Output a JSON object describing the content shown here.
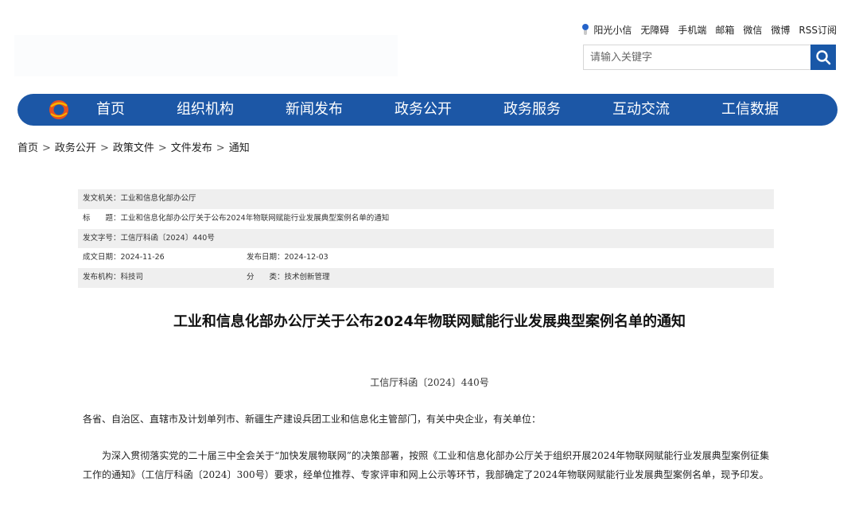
{
  "top_links": [
    "阳光小信",
    "无障碍",
    "手机端",
    "邮箱",
    "微信",
    "微博",
    "RSS订阅"
  ],
  "search": {
    "placeholder": "请输入关键字"
  },
  "nav": {
    "items": [
      "首页",
      "组织机构",
      "新闻发布",
      "政务公开",
      "政务服务",
      "互动交流",
      "工信数据"
    ]
  },
  "breadcrumb": [
    "首页",
    "政务公开",
    "政策文件",
    "文件发布",
    "通知"
  ],
  "meta": {
    "issuer_label": "发文机关：",
    "issuer": "工业和信息化部办公厅",
    "title_label": "标　　题：",
    "title": "工业和信息化部办公厅关于公布2024年物联网赋能行业发展典型案例名单的通知",
    "doc_no_label": "发文字号：",
    "doc_no": "工信厅科函〔2024〕440号",
    "written_label": "成文日期：",
    "written": "2024-11-26",
    "published_label": "发布日期：",
    "published": "2024-12-03",
    "org_label": "发布机构：",
    "org": "科技司",
    "category_label": "分　　类：",
    "category": "技术创新管理"
  },
  "document": {
    "title": "工业和信息化部办公厅关于公布2024年物联网赋能行业发展典型案例名单的通知",
    "number": "工信厅科函〔2024〕440号",
    "salutation": "各省、自治区、直辖市及计划单列市、新疆生产建设兵团工业和信息化主管部门，有关中央企业，有关单位：",
    "paragraph1": "为深入贯彻落实党的二十届三中全会关于“加快发展物联网”的决策部署，按照《工业和信息化部办公厅关于组织开展2024年物联网赋能行业发展典型案例征集工作的通知》（工信厅科函〔2024〕300号）要求，经单位推荐、专家评审和网上公示等环节，我部确定了2024年物联网赋能行业发展典型案例名单，现予印发。"
  },
  "colors": {
    "primary": "#1c57a6",
    "search_button": "#1958a8",
    "meta_shade": "#efefef"
  }
}
